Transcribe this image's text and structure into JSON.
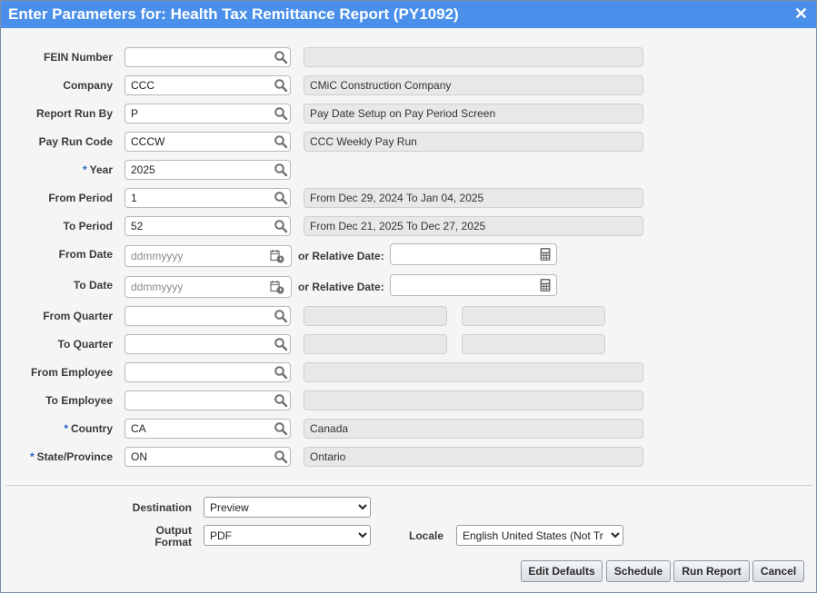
{
  "dialog": {
    "title": "Enter Parameters for: Health Tax Remittance Report (PY1092)",
    "close_glyph": "✕"
  },
  "fields": [
    {
      "label": "FEIN Number",
      "required": false,
      "value": "",
      "description": ""
    },
    {
      "label": "Company",
      "required": false,
      "value": "CCC",
      "description": "CMiC Construction Company"
    },
    {
      "label": "Report Run By",
      "required": false,
      "value": "P",
      "description": "Pay Date Setup on Pay Period Screen"
    },
    {
      "label": "Pay Run Code",
      "required": false,
      "value": "CCCW",
      "description": "CCC Weekly Pay Run"
    },
    {
      "label": "Year",
      "required": true,
      "value": "2025"
    },
    {
      "label": "From Period",
      "required": false,
      "value": "1",
      "description": "From  Dec 29, 2024  To  Jan 04, 2025"
    },
    {
      "label": "To Period",
      "required": false,
      "value": "52",
      "description": "From  Dec 21, 2025  To  Dec 27, 2025"
    },
    {
      "label": "From Date",
      "required": false,
      "value": "",
      "placeholder": "ddmmyyyy",
      "relative_label": "or Relative Date:",
      "relative_value": ""
    },
    {
      "label": "To Date",
      "required": false,
      "value": "",
      "placeholder": "ddmmyyyy",
      "relative_label": "or Relative Date:",
      "relative_value": ""
    },
    {
      "label": "From Quarter",
      "required": false,
      "value": "",
      "description": "",
      "description2": ""
    },
    {
      "label": "To Quarter",
      "required": false,
      "value": "",
      "description": "",
      "description2": ""
    },
    {
      "label": "From Employee",
      "required": false,
      "value": "",
      "description": ""
    },
    {
      "label": "To Employee",
      "required": false,
      "value": "",
      "description": ""
    },
    {
      "label": "Country",
      "required": true,
      "value": "CA",
      "description": "Canada"
    },
    {
      "label": "State/Province",
      "required": true,
      "value": "ON",
      "description": "Ontario"
    }
  ],
  "required_marker": "*",
  "output": {
    "destination_label": "Destination",
    "destination_value": "Preview",
    "format_label_line1": "Output",
    "format_label_line2": "Format",
    "format_value": "PDF",
    "locale_label": "Locale",
    "locale_value": "English United States (Not Tr"
  },
  "buttons": {
    "edit_defaults": "Edit Defaults",
    "schedule": "Schedule",
    "run_report": "Run Report",
    "cancel": "Cancel"
  },
  "icons": {
    "lookup": "search-icon",
    "date": "calendar-icon",
    "relative_date": "calculator-icon"
  },
  "colors": {
    "titlebar": "#4a8fea",
    "required_marker": "#2a64c8",
    "readonly_bg": "#e8e8e8"
  }
}
